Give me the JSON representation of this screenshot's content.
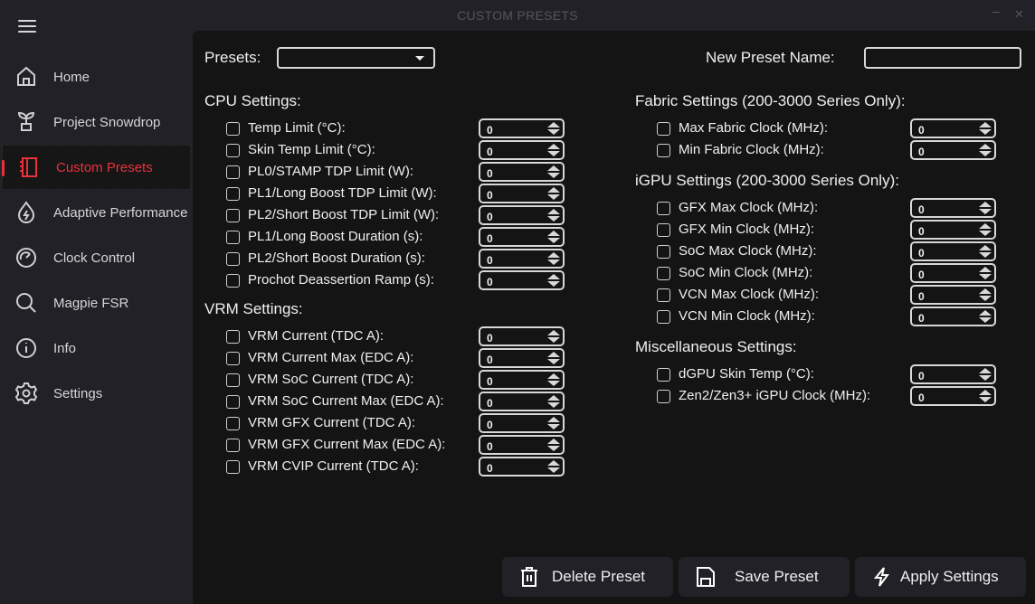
{
  "window": {
    "title": "CUSTOM PRESETS",
    "minimize": "−",
    "close": "✕"
  },
  "sidebar": {
    "items": [
      {
        "label": "Home",
        "icon": "home-icon"
      },
      {
        "label": "Project Snowdrop",
        "icon": "plant-icon"
      },
      {
        "label": "Custom Presets",
        "icon": "notebook-icon",
        "active": true
      },
      {
        "label": "Adaptive Performance",
        "icon": "bolt-drop-icon"
      },
      {
        "label": "Clock Control",
        "icon": "gauge-icon"
      },
      {
        "label": "Magpie FSR",
        "icon": "search-icon"
      },
      {
        "label": "Info",
        "icon": "info-icon"
      },
      {
        "label": "Settings",
        "icon": "gear-icon"
      }
    ]
  },
  "header": {
    "presets_label": "Presets:",
    "presets_value": "",
    "new_name_label": "New Preset Name:",
    "new_name_value": ""
  },
  "sections": [
    {
      "title": "CPU Settings:",
      "rows": [
        {
          "label": "Temp Limit (°C):",
          "value": "0",
          "checked": false
        },
        {
          "label": "Skin Temp Limit (°C):",
          "value": "0",
          "checked": false
        },
        {
          "label": "PL0/STAMP TDP Limit (W):",
          "value": "0",
          "checked": false
        },
        {
          "label": "PL1/Long Boost TDP Limit (W):",
          "value": "0",
          "checked": false
        },
        {
          "label": "PL2/Short Boost TDP Limit (W):",
          "value": "0",
          "checked": false
        },
        {
          "label": "PL1/Long Boost Duration (s):",
          "value": "0",
          "checked": false
        },
        {
          "label": "PL2/Short Boost Duration (s):",
          "value": "0",
          "checked": false
        },
        {
          "label": "Prochot Deassertion Ramp (s):",
          "value": "0",
          "checked": false
        }
      ]
    },
    {
      "title": "VRM Settings:",
      "rows": [
        {
          "label": "VRM Current (TDC A):",
          "value": "0",
          "checked": false
        },
        {
          "label": "VRM Current Max (EDC A):",
          "value": "0",
          "checked": false
        },
        {
          "label": "VRM SoC Current (TDC A):",
          "value": "0",
          "checked": false
        },
        {
          "label": "VRM SoC Current Max (EDC A):",
          "value": "0",
          "checked": false
        },
        {
          "label": "VRM GFX Current (TDC A):",
          "value": "0",
          "checked": false
        },
        {
          "label": "VRM GFX Current Max (EDC A):",
          "value": "0",
          "checked": false
        },
        {
          "label": "VRM CVIP Current (TDC A):",
          "value": "0",
          "checked": false
        }
      ]
    },
    {
      "title": "Fabric Settings (200-3000 Series Only):",
      "rows": [
        {
          "label": "Max Fabric Clock (MHz):",
          "value": "0",
          "checked": false
        },
        {
          "label": "Min Fabric Clock (MHz):",
          "value": "0",
          "checked": false
        }
      ]
    },
    {
      "title": "iGPU Settings (200-3000 Series Only):",
      "rows": [
        {
          "label": "GFX Max Clock (MHz):",
          "value": "0",
          "checked": false
        },
        {
          "label": "GFX Min Clock (MHz):",
          "value": "0",
          "checked": false
        },
        {
          "label": "SoC Max Clock (MHz):",
          "value": "0",
          "checked": false
        },
        {
          "label": "SoC Min Clock (MHz):",
          "value": "0",
          "checked": false
        },
        {
          "label": "VCN Max Clock (MHz):",
          "value": "0",
          "checked": false
        },
        {
          "label": "VCN Min Clock (MHz):",
          "value": "0",
          "checked": false
        }
      ]
    },
    {
      "title": "Miscellaneous Settings:",
      "rows": [
        {
          "label": "dGPU Skin Temp (°C):",
          "value": "0",
          "checked": false
        },
        {
          "label": "Zen2/Zen3+ iGPU Clock (MHz):",
          "value": "0",
          "checked": false
        }
      ]
    }
  ],
  "buttons": {
    "delete": "Delete Preset",
    "save": "Save Preset",
    "apply": "Apply Settings"
  },
  "colors": {
    "accent": "#e8313c",
    "sidebar": "#222127",
    "main": "#141414"
  }
}
